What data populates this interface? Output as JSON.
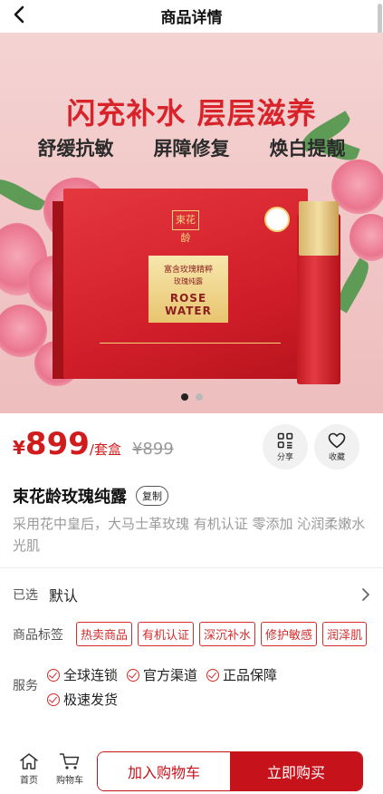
{
  "header": {
    "title": "商品详情"
  },
  "hero": {
    "headline": "闪充补水 层层滋养",
    "benefits": [
      "舒缓抗敏",
      "屏障修复",
      "焕白提靓"
    ],
    "box_logo": "束花龄",
    "box_label_top": "富含玫瑰精粹",
    "box_label_mid": "玫瑰纯露",
    "box_label_en": "ROSE WATER",
    "slides_total": 2,
    "active_slide": 1
  },
  "price": {
    "currency": "¥",
    "amount": "899",
    "unit": "/套盒",
    "original": "¥899"
  },
  "actions": {
    "share": "分享",
    "favorite": "收藏"
  },
  "product": {
    "name": "束花龄玫瑰纯露",
    "copy_label": "复制",
    "description": "采用花中皇后，大马士革玫瑰 有机认证 零添加 沁润柔嫩水光肌"
  },
  "selection": {
    "label": "已选",
    "value": "默认"
  },
  "tags": {
    "label": "商品标签",
    "items": [
      "热卖商品",
      "有机认证",
      "深沉补水",
      "修护敏感",
      "润泽肌"
    ]
  },
  "service": {
    "label": "服务",
    "items": [
      "全球连锁",
      "官方渠道",
      "正品保障",
      "极速发货"
    ]
  },
  "bottom_bar": {
    "home": "首页",
    "cart": "购物车",
    "add_to_cart": "加入购物车",
    "buy_now": "立即购买"
  },
  "colors": {
    "accent": "#c5121b",
    "price": "#d01c1c",
    "muted": "#9a9a9a"
  }
}
